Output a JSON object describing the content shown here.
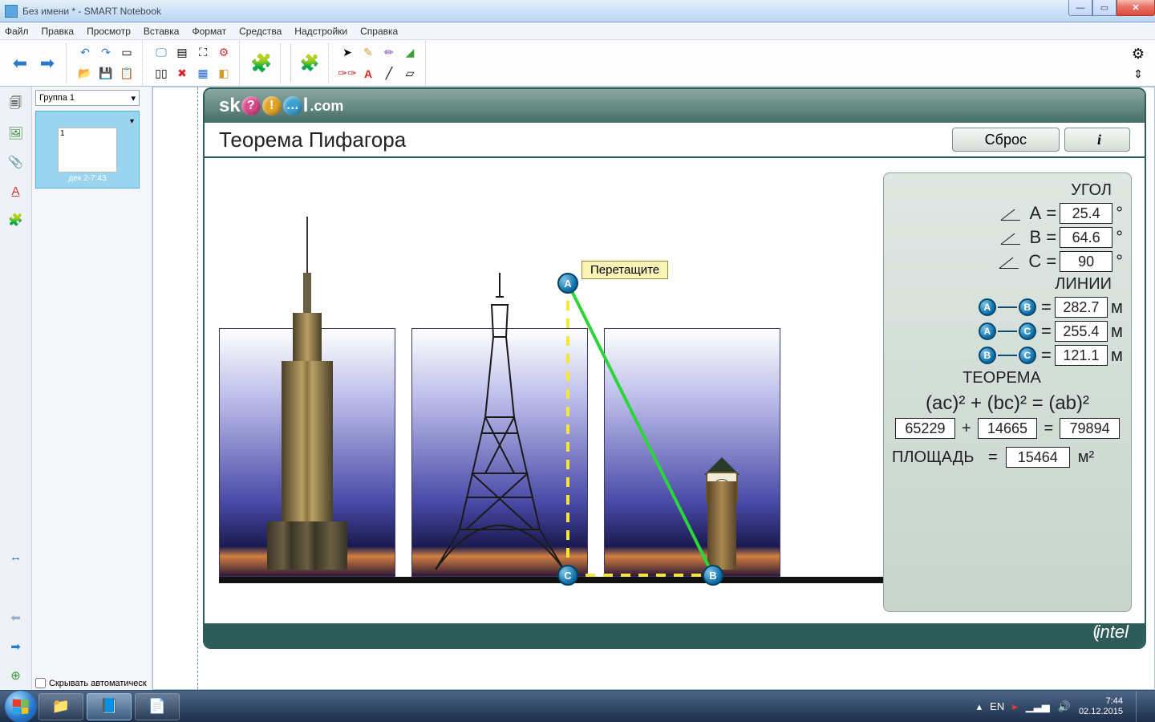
{
  "window": {
    "title": "Без имени * - SMART Notebook",
    "min": "—",
    "max": "▭",
    "close": "✕"
  },
  "menubar": [
    "Файл",
    "Правка",
    "Просмотр",
    "Вставка",
    "Формат",
    "Средства",
    "Надстройки",
    "Справка"
  ],
  "sidebar": {
    "group_label": "Группа 1",
    "thumb_number": "1",
    "thumb_caption": "дек 2-7:43",
    "hide_auto_label": "Скрывать автоматическ"
  },
  "skoool": {
    "logo_prefix": "sk",
    "logo_suffix": "l",
    "logo_domain": ".com",
    "balls": [
      "?",
      "!",
      "…"
    ],
    "title": "Теорема Пифагора",
    "reset": "Сброс",
    "info": "i",
    "drag_tip": "Перетащите",
    "intel": "intel"
  },
  "panel": {
    "angle_heading": "УГОЛ",
    "lines_heading": "ЛИНИИ",
    "theorem_heading": "ТЕОРЕМА",
    "eq": "=",
    "plus": "+",
    "deg": "°",
    "m": "м",
    "m2": "м²",
    "A": "A",
    "B": "B",
    "C": "C",
    "angle_A": "25.4",
    "angle_B": "64.6",
    "angle_C": "90",
    "line_AB": "282.7",
    "line_AC": "255.4",
    "line_BC": "121.1",
    "theorem_formula": "(ac)² + (bc)² = (ab)²",
    "sq_ac": "65229",
    "sq_bc": "14665",
    "sq_ab": "79894",
    "area_label": "ПЛОЩАДЬ",
    "area_val": "15464"
  },
  "points": {
    "A": "A",
    "B": "B",
    "C": "C"
  },
  "taskbar": {
    "lang": "EN",
    "time": "7:44",
    "date": "02.12.2015"
  }
}
